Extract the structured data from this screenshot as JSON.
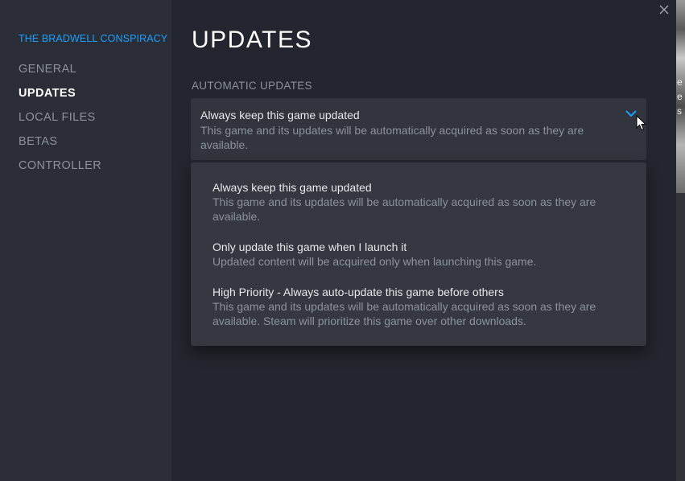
{
  "sidebar": {
    "game_title": "THE BRADWELL CONSPIRACY",
    "items": [
      {
        "label": "GENERAL",
        "active": false
      },
      {
        "label": "UPDATES",
        "active": true
      },
      {
        "label": "LOCAL FILES",
        "active": false
      },
      {
        "label": "BETAS",
        "active": false
      },
      {
        "label": "CONTROLLER",
        "active": false
      }
    ]
  },
  "main": {
    "title": "UPDATES",
    "section_label": "AUTOMATIC UPDATES",
    "dropdown": {
      "selected_title": "Always keep this game updated",
      "selected_desc": "This game and its updates will be automatically acquired as soon as they are available.",
      "icon": "chevron-down-icon"
    },
    "options": [
      {
        "title": "Always keep this game updated",
        "desc": "This game and its updates will be automatically acquired as soon as they are available."
      },
      {
        "title": "Only update this game when I launch it",
        "desc": "Updated content will be acquired only when launching this game."
      },
      {
        "title": "High Priority - Always auto-update this game before others",
        "desc": "This game and its updates will be automatically acquired as soon as they are available. Steam will prioritize this game over other downloads."
      }
    ]
  },
  "window": {
    "close_icon": "close-icon"
  },
  "background_strip": {
    "texts": [
      "e",
      "e",
      "s"
    ]
  },
  "colors": {
    "accent": "#1a9fff",
    "sidebar_bg": "#2b2e36",
    "main_bg": "#23262e",
    "dropdown_bg": "#32353d",
    "menu_bg": "#353841"
  }
}
